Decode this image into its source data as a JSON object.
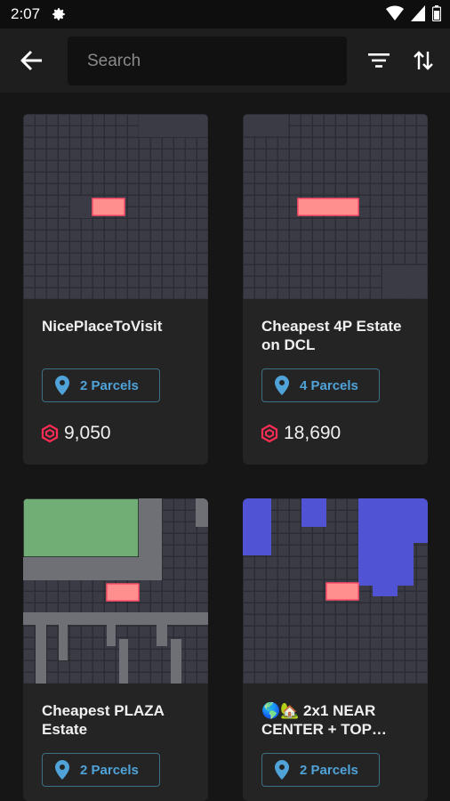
{
  "status": {
    "time": "2:07"
  },
  "search": {
    "placeholder": "Search"
  },
  "cards": [
    {
      "title": "NicePlaceToVisit",
      "parcels": "2 Parcels",
      "price": "9,050"
    },
    {
      "title": "Cheapest 4P Estate on DCL",
      "parcels": "4 Parcels",
      "price": "18,690"
    },
    {
      "title": "Cheapest PLAZA Estate",
      "parcels": "2 Parcels",
      "price": ""
    },
    {
      "title": "🌎🏡 2x1 NEAR CENTER + TOP…",
      "parcels": "2 Parcels",
      "price": ""
    }
  ],
  "colors": {
    "background": "#161616",
    "card": "#242424",
    "parcel_highlight": "#ff8f8f",
    "plaza": "#70ae76",
    "district": "#5054d4",
    "road": "#6f6f76",
    "link": "#4fa3d9",
    "mana": "#ff2d55"
  }
}
